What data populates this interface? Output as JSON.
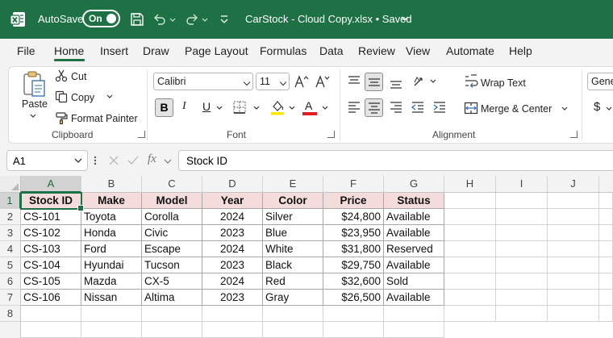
{
  "titlebar": {
    "autosave_label": "AutoSave",
    "autosave_state": "On",
    "document_title": "CarStock - Cloud Copy.xlsx • Saved",
    "accent_color": "#1e7145"
  },
  "tabs": [
    "File",
    "Home",
    "Insert",
    "Draw",
    "Page Layout",
    "Formulas",
    "Data",
    "Review",
    "View",
    "Automate",
    "Help"
  ],
  "active_tab": "Home",
  "ribbon": {
    "clipboard": {
      "label": "Clipboard",
      "paste": "Paste",
      "cut": "Cut",
      "copy": "Copy",
      "format_painter": "Format Painter"
    },
    "font": {
      "label": "Font",
      "font_name": "Calibri",
      "font_size": "11",
      "bold": "B",
      "italic": "I",
      "underline": "U",
      "font_color": "A"
    },
    "alignment": {
      "label": "Alignment",
      "wrap_text": "Wrap Text",
      "merge_center": "Merge & Center"
    },
    "number": {
      "format": "Gene",
      "currency": "$"
    }
  },
  "formula_bar": {
    "name_box": "A1",
    "fx": "fx",
    "value": "Stock ID"
  },
  "columns": [
    "A",
    "B",
    "C",
    "D",
    "E",
    "F",
    "G",
    "H",
    "I",
    "J"
  ],
  "rows": [
    "1",
    "2",
    "3",
    "4",
    "5",
    "6",
    "7",
    "8"
  ],
  "table": {
    "headers": [
      "Stock ID",
      "Make",
      "Model",
      "Year",
      "Color",
      "Price",
      "Status"
    ],
    "rows": [
      [
        "CS-101",
        "Toyota",
        "Corolla",
        "2024",
        "Silver",
        "$24,800",
        "Available"
      ],
      [
        "CS-102",
        "Honda",
        "Civic",
        "2023",
        "Blue",
        "$23,950",
        "Available"
      ],
      [
        "CS-103",
        "Ford",
        "Escape",
        "2024",
        "White",
        "$31,800",
        "Reserved"
      ],
      [
        "CS-104",
        "Hyundai",
        "Tucson",
        "2023",
        "Black",
        "$29,750",
        "Available"
      ],
      [
        "CS-105",
        "Mazda",
        "CX-5",
        "2024",
        "Red",
        "$32,600",
        "Sold"
      ],
      [
        "CS-106",
        "Nissan",
        "Altima",
        "2023",
        "Gray",
        "$26,500",
        "Available"
      ]
    ],
    "header_fill": "#f4dcdc"
  }
}
